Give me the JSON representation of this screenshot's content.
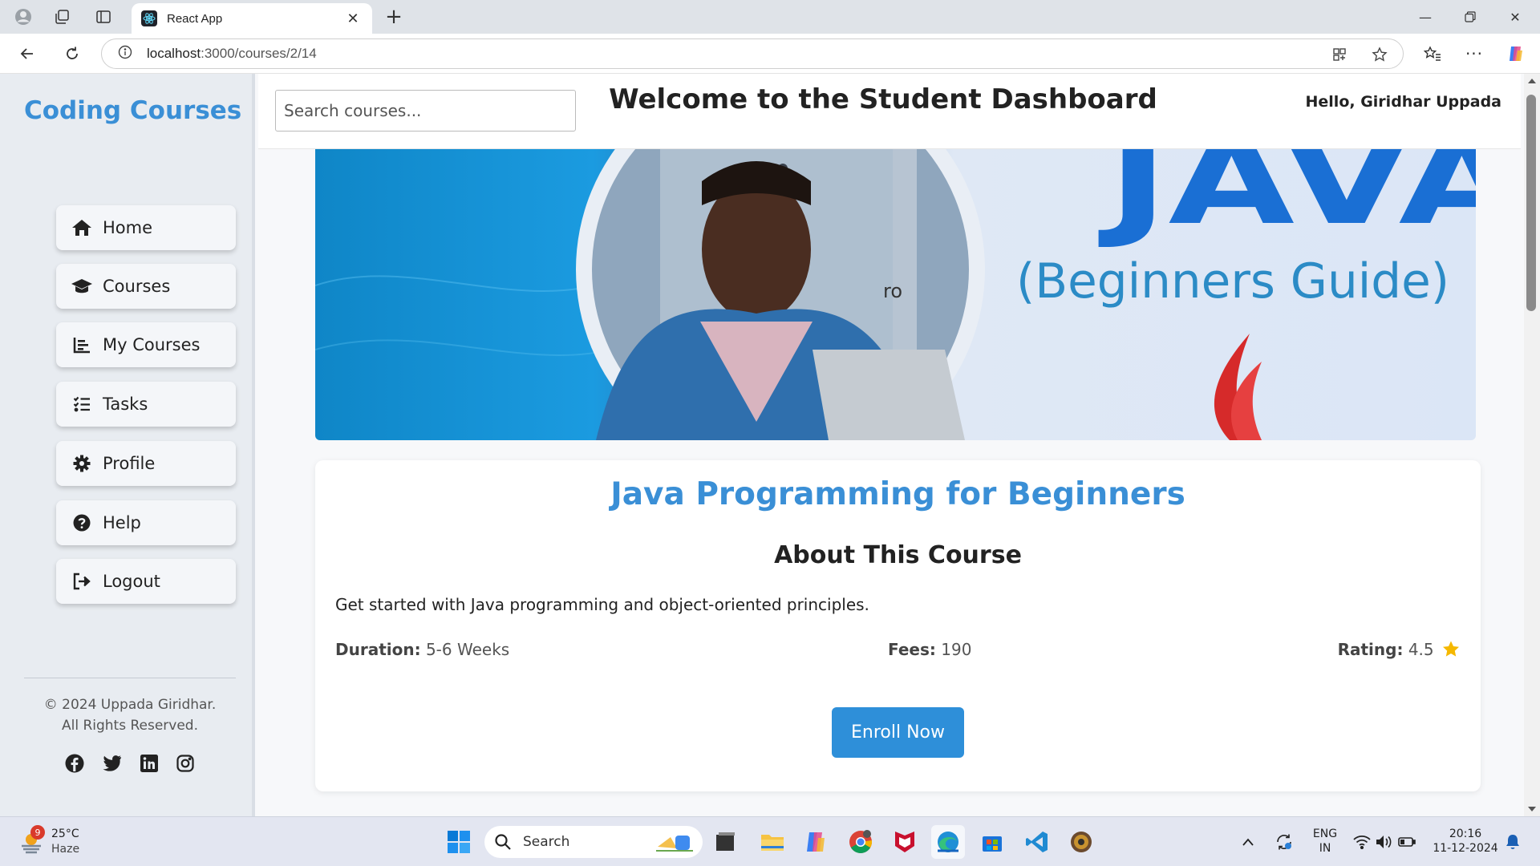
{
  "browser": {
    "tab_title": "React App",
    "url_host": "localhost",
    "url_path": ":3000/courses/2/14"
  },
  "sidebar": {
    "brand": "Coding Courses",
    "items": [
      {
        "label": "Home",
        "icon": "home-icon"
      },
      {
        "label": "Courses",
        "icon": "graduation-cap-icon"
      },
      {
        "label": "My Courses",
        "icon": "list-icon"
      },
      {
        "label": "Tasks",
        "icon": "tasks-icon"
      },
      {
        "label": "Profile",
        "icon": "gear-icon"
      },
      {
        "label": "Help",
        "icon": "help-icon"
      },
      {
        "label": "Logout",
        "icon": "logout-icon"
      }
    ],
    "copyright_line1": "© 2024 Uppada Giridhar.",
    "copyright_line2": "All Rights Reserved.",
    "social": [
      "facebook-icon",
      "twitter-icon",
      "linkedin-icon",
      "instagram-icon"
    ]
  },
  "header": {
    "search_placeholder": "Search courses...",
    "title": "Welcome to the Student Dashboard",
    "greeting": "Hello, Giridhar Uppada"
  },
  "banner": {
    "heading": "JAVA",
    "subheading": "(Beginners Guide)",
    "overlay_text": "ro"
  },
  "course": {
    "title": "Java Programming for Beginners",
    "about_heading": "About This Course",
    "description": "Get started with Java programming and object-oriented principles.",
    "duration_label": "Duration:",
    "duration_value": "5-6 Weeks",
    "fees_label": "Fees:",
    "fees_value": "190",
    "rating_label": "Rating:",
    "rating_value": "4.5",
    "enroll_label": "Enroll Now"
  },
  "taskbar": {
    "weather_temp": "25°C",
    "weather_desc": "Haze",
    "weather_badge": "9",
    "search_label": "Search",
    "lang_top": "ENG",
    "lang_bottom": "IN",
    "time": "20:16",
    "date": "11-12-2024"
  },
  "colors": {
    "accent": "#3a8fd6",
    "button": "#2e8fd9",
    "star": "#f5b800"
  }
}
